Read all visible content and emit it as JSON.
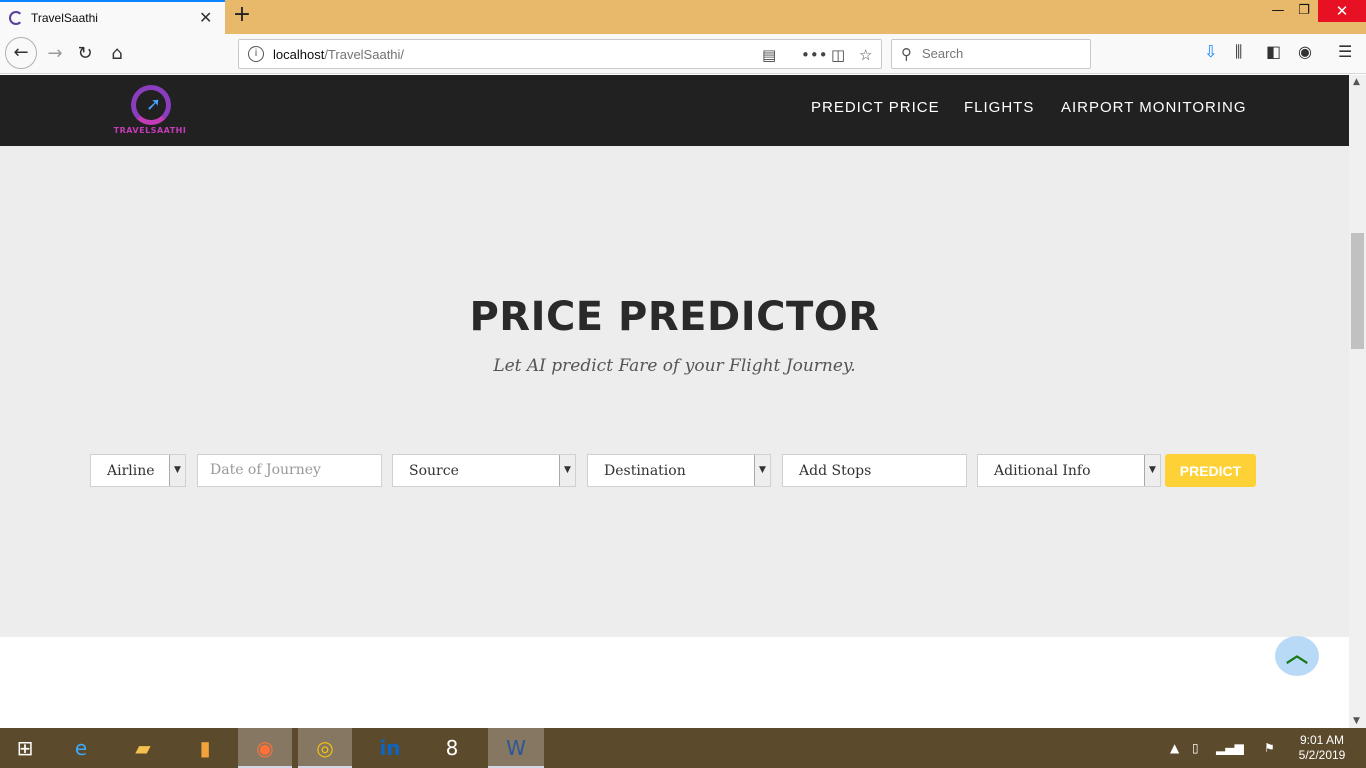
{
  "browser": {
    "tab_title": "TravelSaathi",
    "url_host": "localhost",
    "url_path": "/TravelSaathi/",
    "search_placeholder": "Search",
    "new_tab": "+",
    "tab_close": "✕"
  },
  "site": {
    "logo_text": "TRAVELSAATHI",
    "nav": [
      "PREDICT PRICE",
      "FLIGHTS",
      "AIRPORT MONITORING"
    ]
  },
  "hero": {
    "title": "PRICE PREDICTOR",
    "subtitle": "Let AI predict Fare of your Flight Journey."
  },
  "form": {
    "airline": "Airline",
    "date_placeholder": "Date of Journey",
    "source": "Source",
    "destination": "Destination",
    "stops": "Add Stops",
    "info": "Aditional Info",
    "predict": "PREDICT"
  },
  "taskbar": {
    "time": "9:01 AM",
    "date": "5/2/2019"
  },
  "colors": {
    "accent": "#fed136",
    "navbar": "#212121",
    "hero_bg": "#ededed"
  }
}
